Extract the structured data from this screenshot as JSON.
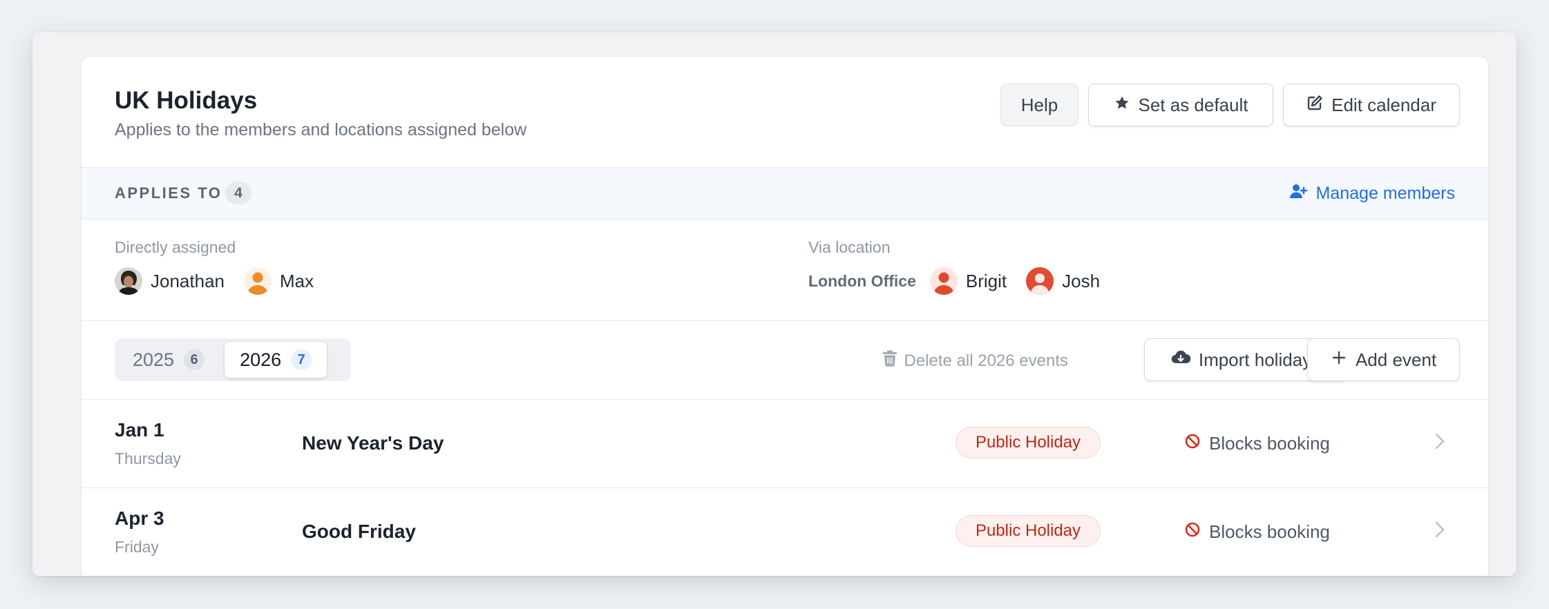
{
  "calendar": {
    "title": "UK Holidays",
    "subtitle": "Applies to the members and locations assigned below",
    "actions": {
      "help_label": "Help",
      "default_label": "Set as default",
      "edit_label": "Edit calendar"
    }
  },
  "applies_to": {
    "label": "APPLIES TO",
    "count": "4",
    "manage_label": "Manage members"
  },
  "assignments": {
    "direct_label": "Directly assigned",
    "direct_members": [
      {
        "name": "Jonathan",
        "avatar": "photo"
      },
      {
        "name": "Max",
        "avatar": "orange-person"
      }
    ],
    "location_label": "Via location",
    "location_name": "London Office",
    "location_members": [
      {
        "name": "Brigit",
        "avatar": "red-person"
      },
      {
        "name": "Josh",
        "avatar": "red-person-circle"
      }
    ]
  },
  "years": {
    "tabs": [
      {
        "year": "2025",
        "count": "6",
        "active": false
      },
      {
        "year": "2026",
        "count": "7",
        "active": true
      }
    ],
    "delete_label": "Delete all 2026 events",
    "import_label": "Import holidays",
    "add_label": "Add event"
  },
  "events": [
    {
      "date": "Jan 1",
      "weekday": "Thursday",
      "name": "New Year's Day",
      "type": "Public Holiday",
      "booking": "Blocks booking"
    },
    {
      "date": "Apr 3",
      "weekday": "Friday",
      "name": "Good Friday",
      "type": "Public Holiday",
      "booking": "Blocks booking"
    }
  ],
  "colors": {
    "accent": "#1f6fe0",
    "holiday_badge": "#b72a18",
    "blocks_icon": "#d22c1e"
  }
}
